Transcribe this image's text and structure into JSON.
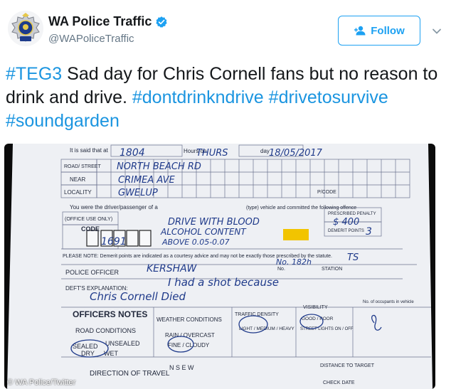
{
  "account": {
    "display_name": "WA Police Traffic",
    "handle": "@WAPoliceTraffic",
    "avatar_icon": "police-badge-icon",
    "verified_icon": "verified-badge-icon"
  },
  "follow_button": {
    "label": "Follow",
    "icon": "add-user-icon"
  },
  "menu_icon": "chevron-down-icon",
  "tweet": {
    "segments": [
      {
        "text": "#TEG3",
        "type": "hashtag"
      },
      {
        "text": " Sad day for Chris Cornell fans but no reason to drink and drive. ",
        "type": "text"
      },
      {
        "text": "#dontdrinkndrive",
        "type": "hashtag"
      },
      {
        "text": " ",
        "type": "text"
      },
      {
        "text": "#drivetosurvive",
        "type": "hashtag"
      },
      {
        "text": " ",
        "type": "text"
      },
      {
        "text": "#soundgarden",
        "type": "hashtag"
      }
    ]
  },
  "photo": {
    "credit": "© WA Police/Twitter",
    "form": {
      "it_is_said": "It is said that at",
      "hours_on": "Hours on",
      "day": "day",
      "road_street": "ROAD/ STREET",
      "near": "NEAR",
      "locality": "LOCALITY",
      "pcode": "P/CODE",
      "driver_line": "You were the driver/passenger of a",
      "vehicle_line": "(type) vehicle and committed the following offence",
      "office_use": "(OFFICE USE ONLY)",
      "code": "CODE",
      "prescribed_penalty": "PRESCRIBED PENALTY",
      "demerit_points": "DEMERIT POINTS",
      "please_note": "PLEASE NOTE: Demerit points are indicated as a courtesy advice and may not be exactly those prescribed by the statute.",
      "no": "No.",
      "station": "STATION",
      "police_officer": "POLICE OFFICER",
      "defts_explanation": "DEFT'S EXPLANATION:",
      "officers_notes": "OFFICERS NOTES",
      "road_conditions": "ROAD CONDITIONS",
      "weather_conditions": "WEATHER CONDITIONS",
      "traffic_density": "TRAFFIC DENSITY",
      "visibility": "VISIBILITY",
      "occupants": "No. of occupants in vehicle",
      "sealed": "SEALED",
      "unsealed": "UNSEALED",
      "dry": "DRY",
      "wet": "WET",
      "rain_overcast": "RAIN / OVERCAST",
      "fine_cloudy": "FINE / CLOUDY",
      "light_medium_heavy": "LIGHT / MEDIUM / HEAVY",
      "good_poor": "GOOD / POOR",
      "street_lights": "STREET LIGHTS ON / OFF",
      "direction": "DIRECTION OF TRAVEL",
      "nsew": "N S E W",
      "distance": "DISTANCE TO TARGET",
      "check_date": "CHECK DATE",
      "handwritten": {
        "time": "1804",
        "day": "THURS",
        "date": "18/05/2017",
        "street": "NORTH BEACH RD",
        "near": "CRIMEA AVE",
        "locality": "GWELUP",
        "offence_1": "DRIVE WITH BLOOD",
        "offence_2": "ALCOHOL CONTENT",
        "offence_3": "ABOVE 0.05-0.07",
        "penalty": "$ 400",
        "points": "3",
        "code": "1691",
        "officer": "KERSHAW",
        "number": "No. 182h",
        "station": "TS",
        "explanation_1": "I had a shot because",
        "explanation_2": "Chris Cornell Died"
      }
    }
  }
}
